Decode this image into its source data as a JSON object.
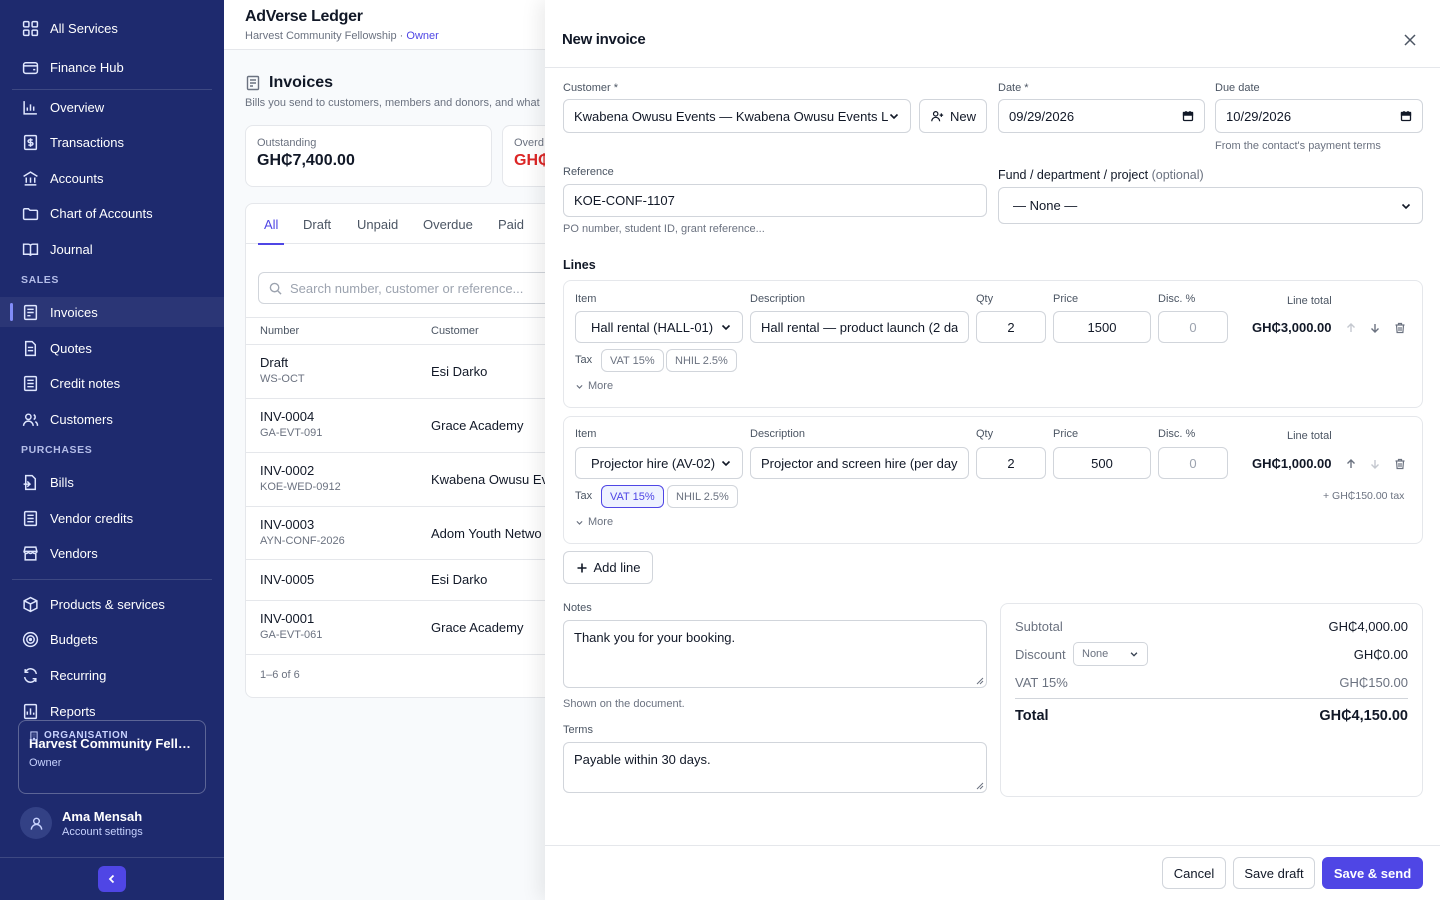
{
  "sidebar": {
    "top_items": [
      {
        "label": "All Services",
        "icon": "grid-icon"
      },
      {
        "label": "Finance Hub",
        "icon": "wallet-icon"
      }
    ],
    "main_items": [
      {
        "label": "Overview",
        "icon": "bar-chart-icon"
      },
      {
        "label": "Transactions",
        "icon": "dollar-receipt-icon"
      },
      {
        "label": "Accounts",
        "icon": "bank-icon"
      },
      {
        "label": "Chart of Accounts",
        "icon": "folder-icon"
      },
      {
        "label": "Journal",
        "icon": "book-open-icon"
      }
    ],
    "sales_label": "SALES",
    "sales_items": [
      {
        "label": "Invoices",
        "icon": "invoice-icon",
        "active": true
      },
      {
        "label": "Quotes",
        "icon": "quote-document-icon"
      },
      {
        "label": "Credit notes",
        "icon": "credit-note-icon"
      },
      {
        "label": "Customers",
        "icon": "users-icon"
      }
    ],
    "purchases_label": "PURCHASES",
    "purchases_items": [
      {
        "label": "Bills",
        "icon": "bill-icon"
      },
      {
        "label": "Vendor credits",
        "icon": "vendor-credit-icon"
      },
      {
        "label": "Vendors",
        "icon": "store-icon"
      }
    ],
    "other_items": [
      {
        "label": "Products & services",
        "icon": "package-icon"
      },
      {
        "label": "Budgets",
        "icon": "target-icon"
      },
      {
        "label": "Recurring",
        "icon": "refresh-icon"
      },
      {
        "label": "Reports",
        "icon": "report-icon"
      }
    ],
    "org": {
      "label": "ORGANISATION",
      "name": "Harvest Community Fello...",
      "role": "Owner"
    },
    "user": {
      "name": "Ama Mensah",
      "sub": "Account settings"
    }
  },
  "page": {
    "app_title": "AdVerse Ledger",
    "org_name": "Harvest Community Fellowship",
    "separator": "·",
    "role": "Owner",
    "title": "Invoices",
    "subtitle": "Bills you send to customers, members and donors, and what",
    "stats": [
      {
        "label": "Outstanding",
        "value": "GH₵7,400.00",
        "color": "#111827"
      },
      {
        "label": "Overd",
        "value": "GH₵",
        "color": "#dc2626"
      }
    ],
    "tabs": [
      "All",
      "Draft",
      "Unpaid",
      "Overdue",
      "Paid"
    ],
    "search_placeholder": "Search number, customer or reference...",
    "columns": [
      "Number",
      "Customer"
    ],
    "rows": [
      {
        "number": "Draft",
        "ref": "WS-OCT",
        "customer": "Esi Darko"
      },
      {
        "number": "INV-0004",
        "ref": "GA-EVT-091",
        "customer": "Grace Academy"
      },
      {
        "number": "INV-0002",
        "ref": "KOE-WED-0912",
        "customer": "Kwabena Owusu Ev"
      },
      {
        "number": "INV-0003",
        "ref": "AYN-CONF-2026",
        "customer": "Adom Youth Netwo"
      },
      {
        "number": "INV-0005",
        "ref": "",
        "customer": "Esi Darko"
      },
      {
        "number": "INV-0001",
        "ref": "GA-EVT-061",
        "customer": "Grace Academy"
      }
    ],
    "pager": "1–6 of 6"
  },
  "drawer": {
    "title": "New invoice",
    "customer_label": "Customer *",
    "customer_value": "Kwabena Owusu Events — Kwabena Owusu Events L",
    "new_label": "New",
    "date_label": "Date *",
    "date_value": "09/29/2026",
    "due_label": "Due date",
    "due_value": "10/29/2026",
    "due_hint": "From the contact's payment terms",
    "reference_label": "Reference",
    "reference_value": "KOE-CONF-1107",
    "reference_hint": "PO number, student ID, grant reference...",
    "fund_label": "Fund / department / project",
    "fund_optional": "(optional)",
    "fund_value": "— None —",
    "lines_label": "Lines",
    "col_item": "Item",
    "col_desc": "Description",
    "col_qty": "Qty",
    "col_price": "Price",
    "col_disc": "Disc. %",
    "col_total": "Line total",
    "tax_label": "Tax",
    "more_label": "More",
    "lines": [
      {
        "item": "Hall rental (HALL-01)",
        "description": "Hall rental — product launch (2 da",
        "qty": "2",
        "price": "1500",
        "disc": "0",
        "total": "GH₵3,000.00",
        "taxes": [
          {
            "label": "VAT 15%",
            "on": false
          },
          {
            "label": "NHIL 2.5%",
            "on": false
          }
        ],
        "tax_note": ""
      },
      {
        "item": "Projector hire (AV-02)",
        "description": "Projector and screen hire (per day",
        "qty": "2",
        "price": "500",
        "disc": "0",
        "total": "GH₵1,000.00",
        "taxes": [
          {
            "label": "VAT 15%",
            "on": true
          },
          {
            "label": "NHIL 2.5%",
            "on": false
          }
        ],
        "tax_note": "+ GH₵150.00 tax"
      }
    ],
    "add_line": "Add line",
    "notes_label": "Notes",
    "notes_value": "Thank you for your booking.",
    "notes_hint": "Shown on the document.",
    "terms_label": "Terms",
    "terms_value": "Payable within 30 days.",
    "totals": {
      "subtotal_label": "Subtotal",
      "subtotal": "GH₵4,000.00",
      "discount_label": "Discount",
      "discount_option": "None",
      "discount": "GH₵0.00",
      "vat_label": "VAT 15%",
      "vat": "GH₵150.00",
      "total_label": "Total",
      "total": "GH₵4,150.00"
    },
    "cancel": "Cancel",
    "save_draft": "Save draft",
    "save_send": "Save & send"
  },
  "colors": {
    "sidebar": "#1e2a6e",
    "accent": "#4f46e5",
    "danger": "#dc2626"
  }
}
